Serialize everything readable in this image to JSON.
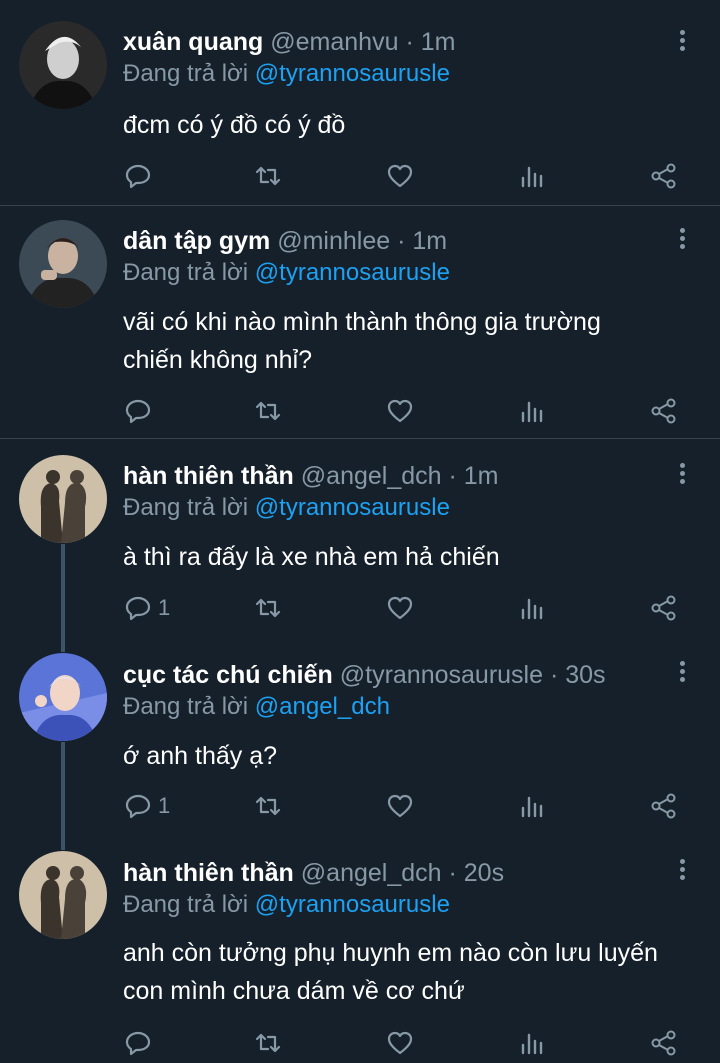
{
  "tweets": [
    {
      "name": "xuân quang",
      "handle": "@emanhvu",
      "time": "1m",
      "reply_prefix": "Đang trả lời",
      "reply_to": "@tyrannosaurusle",
      "lines": [
        "đcm có ý đồ có ý đồ"
      ],
      "reply_count": ""
    },
    {
      "name": "dân tập gym",
      "handle": "@minhlee",
      "time": "1m",
      "reply_prefix": "Đang trả lời",
      "reply_to": "@tyrannosaurusle",
      "lines": [
        "vãi có khi nào mình thành thông gia trường",
        "chiến không nhỉ?"
      ],
      "reply_count": ""
    },
    {
      "name": "hàn thiên thần",
      "handle": "@angel_dch",
      "time": "1m",
      "reply_prefix": "Đang trả lời",
      "reply_to": "@tyrannosaurusle",
      "lines": [
        "à thì ra đấy là xe nhà em hả chiến"
      ],
      "reply_count": "1"
    },
    {
      "name": "cục tác chú chiến",
      "handle": "@tyrannosaurusle",
      "time": "30s",
      "reply_prefix": "Đang trả lời",
      "reply_to": "@angel_dch",
      "lines": [
        "ớ anh thấy ạ?"
      ],
      "reply_count": "1"
    },
    {
      "name": "hàn thiên thần",
      "handle": "@angel_dch",
      "time": "20s",
      "reply_prefix": "Đang trả lời",
      "reply_to": "@tyrannosaurusle",
      "lines": [
        "anh còn tưởng phụ huynh em nào còn lưu luyến",
        "con mình chưa dám về cơ chứ"
      ],
      "reply_count": ""
    }
  ],
  "separator": "·"
}
